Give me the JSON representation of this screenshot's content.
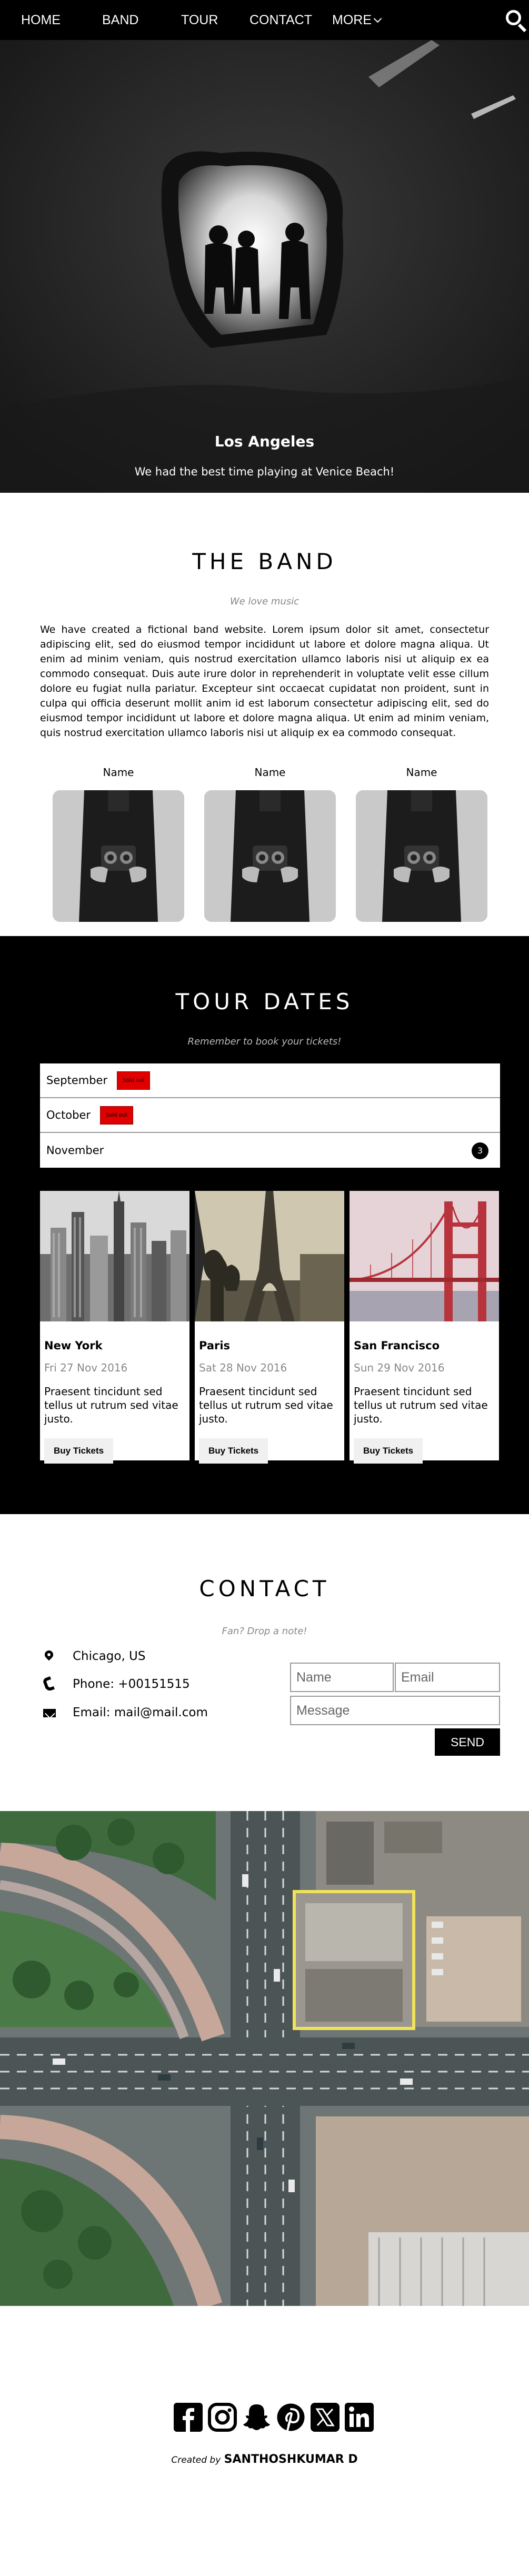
{
  "nav": {
    "items": [
      "HOME",
      "BAND",
      "TOUR",
      "CONTACT"
    ],
    "more_label": "MORE"
  },
  "hero": {
    "title": "Los Angeles",
    "subtitle": "We had the best time playing at Venice Beach!"
  },
  "band": {
    "title": "THE BAND",
    "tagline": "We love music",
    "description": "We have created a fictional band website. Lorem ipsum dolor sit amet, consectetur adipiscing elit, sed do eiusmod tempor incididunt ut labore et dolore magna aliqua. Ut enim ad minim veniam, quis nostrud exercitation ullamco laboris nisi ut aliquip ex ea commodo consequat. Duis aute irure dolor in reprehenderit in voluptate velit esse cillum dolore eu fugiat nulla pariatur. Excepteur sint occaecat cupidatat non proident, sunt in culpa qui officia deserunt mollit anim id est laborum consectetur adipiscing elit, sed do eiusmod tempor incididunt ut labore et dolore magna aliqua. Ut enim ad minim veniam, quis nostrud exercitation ullamco laboris nisi ut aliquip ex ea commodo consequat.",
    "members": [
      {
        "name": "Name"
      },
      {
        "name": "Name"
      },
      {
        "name": "Name"
      }
    ]
  },
  "tour": {
    "title": "TOUR DATES",
    "tagline": "Remember to book your tickets!",
    "months": [
      {
        "label": "September",
        "status": "Sold out"
      },
      {
        "label": "October",
        "status": "Sold out"
      },
      {
        "label": "November",
        "count": "3"
      }
    ],
    "cities": [
      {
        "name": "New York",
        "date": "Fri 27 Nov 2016",
        "desc": "Praesent tincidunt sed tellus ut rutrum sed vitae justo.",
        "button": "Buy Tickets"
      },
      {
        "name": "Paris",
        "date": "Sat 28 Nov 2016",
        "desc": "Praesent tincidunt sed tellus ut rutrum sed vitae justo.",
        "button": "Buy Tickets"
      },
      {
        "name": "San Francisco",
        "date": "Sun 29 Nov 2016",
        "desc": "Praesent tincidunt sed tellus ut rutrum sed vitae justo.",
        "button": "Buy Tickets"
      }
    ]
  },
  "contact": {
    "title": "CONTACT",
    "tagline": "Fan? Drop a note!",
    "location": "Chicago, US",
    "phone": "Phone: +00151515",
    "email": "Email: mail@mail.com",
    "form": {
      "name_placeholder": "Name",
      "email_placeholder": "Email",
      "message_placeholder": "Message",
      "send_label": "SEND"
    }
  },
  "footer": {
    "social_icons": [
      "facebook-icon",
      "instagram-icon",
      "snapchat-icon",
      "pinterest-icon",
      "x-twitter-icon",
      "linkedin-icon"
    ],
    "created_by": "Created by",
    "author": "SANTHOSHKUMAR D"
  },
  "colors": {
    "nav_bg": "#000000",
    "sold_out": "#e00000",
    "tour_bg": "#000000"
  }
}
